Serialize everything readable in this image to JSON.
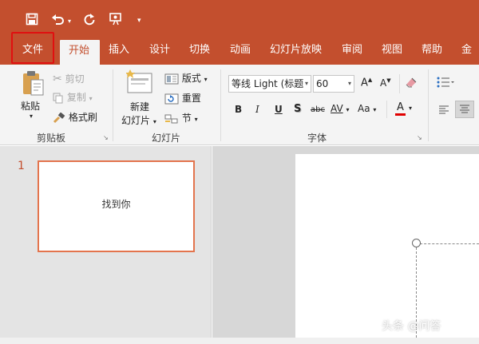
{
  "colors": {
    "accent": "#c34f2e",
    "ribbon_bg": "#f4f4f4",
    "highlight": "#e01010",
    "thumb_border": "#e3744d"
  },
  "titlebar": {
    "save_icon": "save-icon",
    "undo_icon": "undo-icon",
    "redo_icon": "repeat-icon",
    "present_icon": "present-from-start-icon",
    "customize_icon": "customize-toolbar-icon"
  },
  "tabs": [
    {
      "label": "文件"
    },
    {
      "label": "开始"
    },
    {
      "label": "插入"
    },
    {
      "label": "设计"
    },
    {
      "label": "切换"
    },
    {
      "label": "动画"
    },
    {
      "label": "幻灯片放映"
    },
    {
      "label": "审阅"
    },
    {
      "label": "视图"
    },
    {
      "label": "帮助"
    },
    {
      "label": "金"
    }
  ],
  "clipboard": {
    "paste_label": "粘贴",
    "cut_label": "剪切",
    "copy_label": "复制",
    "format_painter_label": "格式刷",
    "group_label": "剪贴板"
  },
  "slides_group": {
    "new_slide_line1": "新建",
    "new_slide_line2": "幻灯片",
    "layout_label": "版式",
    "reset_label": "重置",
    "section_label": "节",
    "group_label": "幻灯片"
  },
  "font_group": {
    "font_name": "等线 Light (标题",
    "font_size": "60",
    "grow_font": "A",
    "shrink_font": "A",
    "bold": "B",
    "italic": "I",
    "underline": "U",
    "shadow": "S",
    "strikethrough": "abc",
    "spacing": "AV",
    "change_case": "Aa",
    "font_color": "A",
    "group_label": "字体"
  },
  "slides_pane": {
    "slide_number": "1",
    "slide_text": "找到你"
  },
  "watermark": "头条 @问答"
}
